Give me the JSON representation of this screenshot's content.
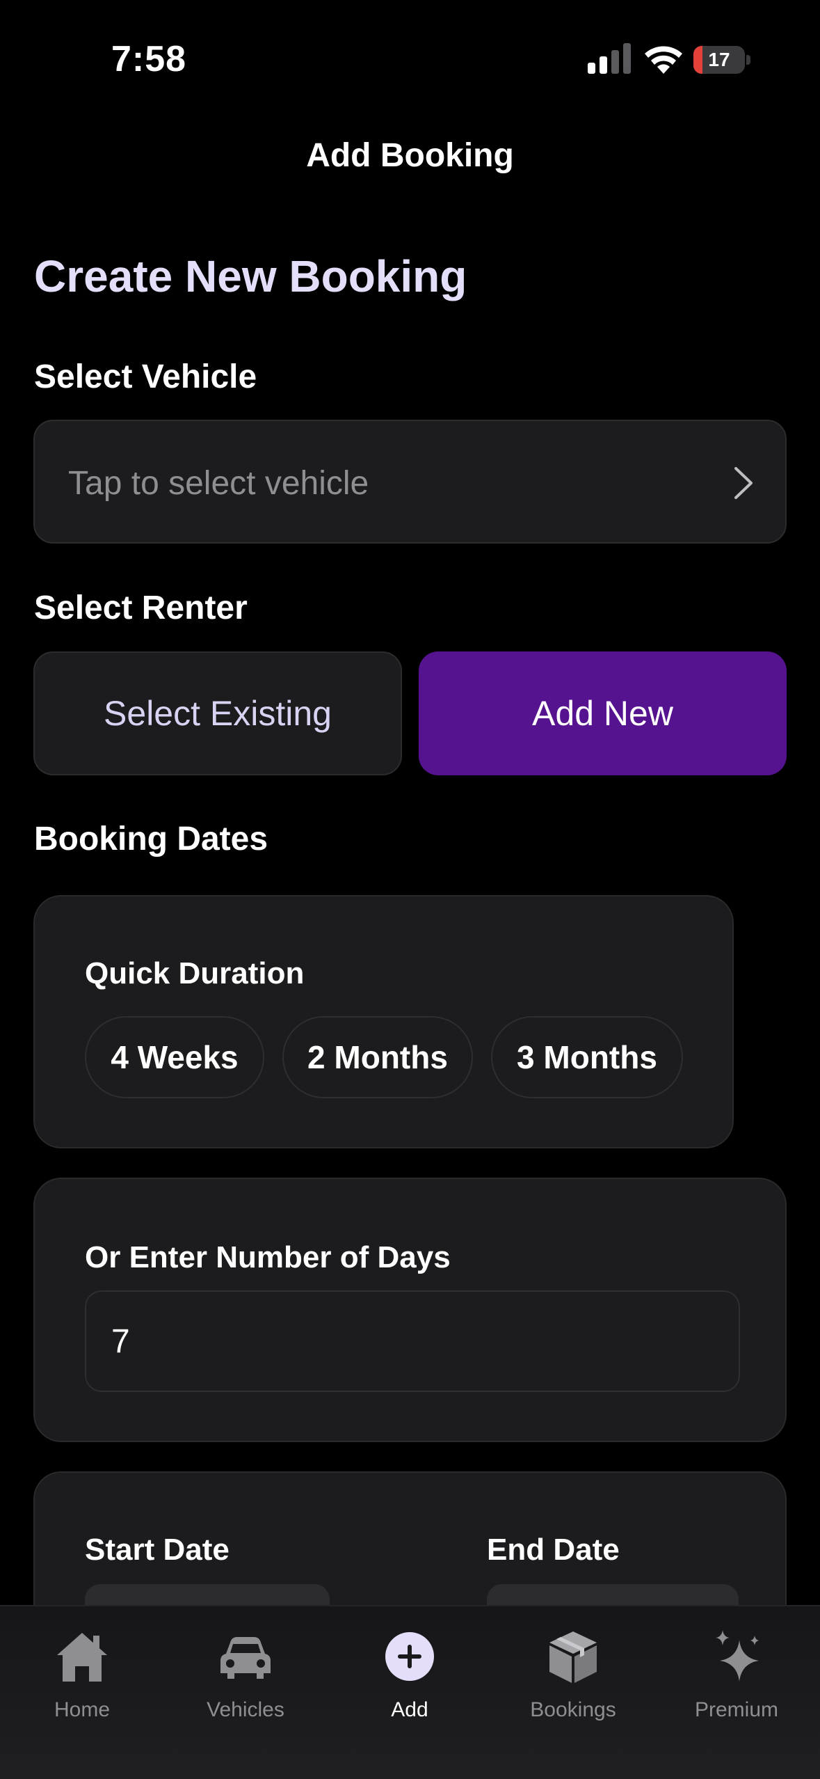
{
  "status_bar": {
    "time": "7:58",
    "battery_level": "17",
    "battery_fraction": 0.17
  },
  "nav": {
    "title": "Add Booking"
  },
  "page_title": "Create New Booking",
  "vehicle": {
    "label": "Select Vehicle",
    "placeholder": "Tap to select vehicle"
  },
  "renter": {
    "label": "Select Renter",
    "existing_label": "Select Existing",
    "new_label": "Add New",
    "selected": "Add New"
  },
  "dates": {
    "label": "Booking Dates",
    "quick_duration": {
      "label": "Quick Duration",
      "options": [
        "4 Weeks",
        "2 Months",
        "3 Months"
      ]
    },
    "days": {
      "label": "Or Enter Number of Days",
      "value": "7"
    },
    "start_label": "Start Date",
    "end_label": "End Date"
  },
  "tabs": [
    {
      "label": "Home",
      "icon": "house-icon"
    },
    {
      "label": "Vehicles",
      "icon": "car-icon"
    },
    {
      "label": "Add",
      "icon": "plus-circle-icon"
    },
    {
      "label": "Bookings",
      "icon": "box-icon"
    },
    {
      "label": "Premium",
      "icon": "sparkles-icon"
    }
  ],
  "active_tab": "Add",
  "colors": {
    "accent": "#56138f",
    "title": "#e4defa",
    "background": "#000000",
    "card": "#1c1c1e",
    "battery_low": "#e5413b"
  }
}
